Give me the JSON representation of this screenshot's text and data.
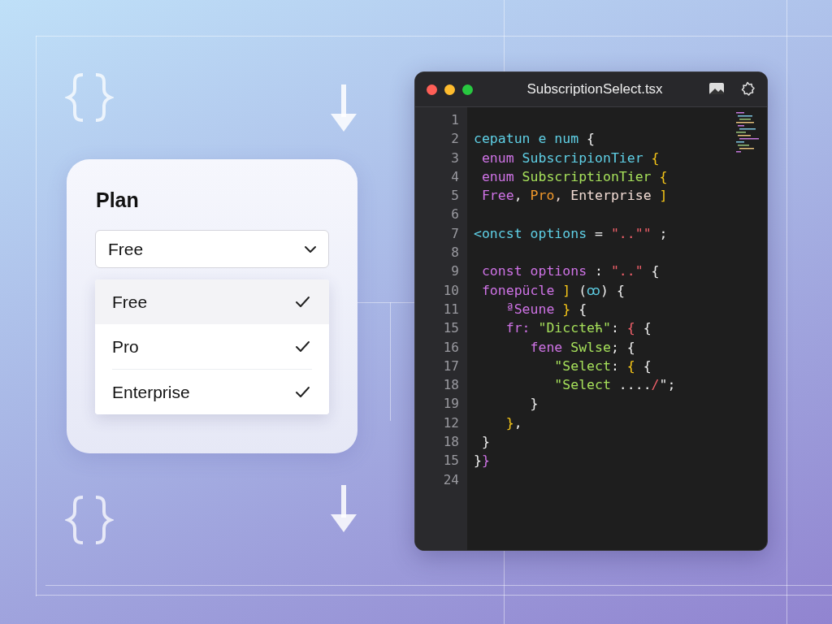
{
  "plan_card": {
    "label": "Plan",
    "select": {
      "value": "Free"
    },
    "options": [
      {
        "label": "Free",
        "selected": true,
        "checked": true
      },
      {
        "label": "Pro",
        "selected": false,
        "checked": true
      },
      {
        "label": "Enterprise",
        "selected": false,
        "checked": true
      }
    ]
  },
  "editor": {
    "title": "SubscriptionSelect.tsx",
    "lines": [
      {
        "number": "1"
      },
      {
        "number": "2",
        "tokens": [
          {
            "text": "cepatun e num ",
            "kind": "name"
          },
          {
            "text": "{",
            "kind": "plain"
          }
        ]
      },
      {
        "number": "3",
        "tokens": [
          {
            "text": " enum ",
            "kind": "keyword"
          },
          {
            "text": "SubscripionTier ",
            "kind": "name"
          },
          {
            "text": "{",
            "kind": "brace"
          }
        ]
      },
      {
        "number": "4",
        "tokens": [
          {
            "text": " enum ",
            "kind": "keyword"
          },
          {
            "text": "SubscriptionTier ",
            "kind": "type"
          },
          {
            "text": "{",
            "kind": "brace"
          }
        ]
      },
      {
        "number": "5",
        "tokens": [
          {
            "text": " Free",
            "kind": "keyword"
          },
          {
            "text": ", ",
            "kind": "plain"
          },
          {
            "text": "Pro",
            "kind": "orange"
          },
          {
            "text": ", Enterprise ",
            "kind": "soft"
          },
          {
            "text": "]",
            "kind": "brace"
          }
        ]
      },
      {
        "number": "6"
      },
      {
        "number": "7",
        "tokens": [
          {
            "text": "<oncst options ",
            "kind": "name"
          },
          {
            "text": "= ",
            "kind": "plain"
          },
          {
            "text": "\"..\"\"",
            "kind": "red"
          },
          {
            "text": " ;",
            "kind": "plain"
          }
        ]
      },
      {
        "number": "8"
      },
      {
        "number": "9",
        "tokens": [
          {
            "text": " const options ",
            "kind": "keyword"
          },
          {
            "text": ": ",
            "kind": "plain"
          },
          {
            "text": "\"..\"",
            "kind": "red"
          },
          {
            "text": " {",
            "kind": "plain"
          }
        ]
      },
      {
        "number": "10",
        "tokens": [
          {
            "text": " fonepücle ",
            "kind": "keyword"
          },
          {
            "text": "]",
            "kind": "brace"
          },
          {
            "text": " (",
            "kind": "plain"
          },
          {
            "text": "ꝏ",
            "kind": "name"
          },
          {
            "text": ") {",
            "kind": "plain"
          }
        ]
      },
      {
        "number": "11",
        "tokens": [
          {
            "text": "    ªSeune ",
            "kind": "keyword"
          },
          {
            "text": "}",
            "kind": "brace"
          },
          {
            "text": " {",
            "kind": "plain"
          }
        ]
      },
      {
        "number": "15",
        "tokens": [
          {
            "text": "    fr: ",
            "kind": "keyword"
          },
          {
            "text": "\"Diccteћ\"",
            "kind": "type"
          },
          {
            "text": ": ",
            "kind": "plain"
          },
          {
            "text": "{",
            "kind": "red"
          },
          {
            "text": " {",
            "kind": "plain"
          }
        ]
      },
      {
        "number": "16",
        "tokens": [
          {
            "text": "       fene ",
            "kind": "keyword"
          },
          {
            "text": "Swlse",
            "kind": "type"
          },
          {
            "text": "; {",
            "kind": "plain"
          }
        ]
      },
      {
        "number": "17",
        "tokens": [
          {
            "text": "          \"Select",
            "kind": "type"
          },
          {
            "text": ": ",
            "kind": "plain"
          },
          {
            "text": "{",
            "kind": "brace"
          },
          {
            "text": " {",
            "kind": "plain"
          }
        ]
      },
      {
        "number": "18",
        "tokens": [
          {
            "text": "          \"Select",
            "kind": "type"
          },
          {
            "text": " ....",
            "kind": "plain"
          },
          {
            "text": "/",
            "kind": "red"
          },
          {
            "text": "\";",
            "kind": "plain"
          }
        ]
      },
      {
        "number": "19",
        "tokens": [
          {
            "text": "       }",
            "kind": "plain"
          }
        ]
      },
      {
        "number": "12",
        "tokens": [
          {
            "text": "    }",
            "kind": "brace"
          },
          {
            "text": ",",
            "kind": "plain"
          }
        ]
      },
      {
        "number": "18",
        "tokens": [
          {
            "text": " }",
            "kind": "plain"
          }
        ]
      },
      {
        "number": "15",
        "tokens": [
          {
            "text": "}",
            "kind": "plain"
          },
          {
            "text": "}",
            "kind": "keyword"
          }
        ]
      },
      {
        "number": "24"
      }
    ]
  }
}
